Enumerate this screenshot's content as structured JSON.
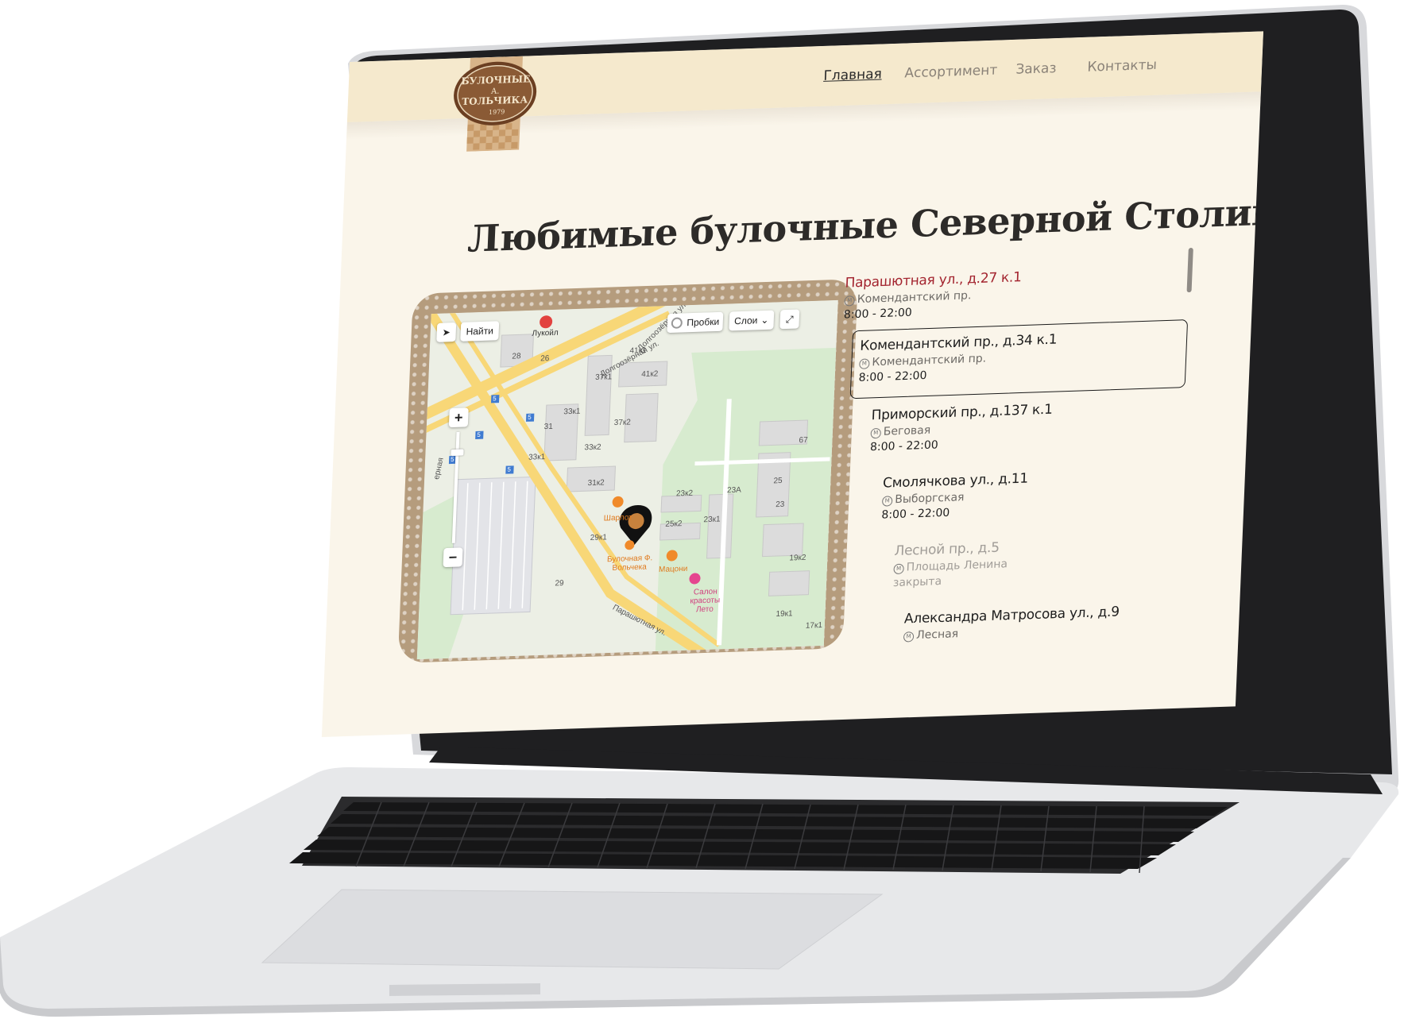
{
  "nav": {
    "home": "Главная",
    "assortment": "Ассортимент",
    "order": "Заказ",
    "contacts": "Контакты"
  },
  "logo": {
    "line1": "БУЛОЧНЫЕ",
    "line2": "А.",
    "line3": "ТОЛЬЧИКА",
    "est": "1979"
  },
  "hero": {
    "title": "Любимые булочные Северной Столицы"
  },
  "map": {
    "find_label": "Найти",
    "traffic_label": "Пробки",
    "layers_label": "Слои",
    "zoom_in": "+",
    "zoom_out": "−",
    "streets": [
      "Долгоозёрная ул.",
      "Долгоозёрная ул.",
      "Парашютная ул.",
      "ерная"
    ],
    "pois": [
      {
        "name": "Лукойл"
      },
      {
        "name": "Шарлот"
      },
      {
        "name": "Булочная Ф. Вольчека"
      },
      {
        "name": "Мацони"
      },
      {
        "name": "Салон красоты Лето"
      }
    ],
    "house_numbers": [
      "28",
      "26",
      "41к1",
      "37к1",
      "41к2",
      "33к1",
      "31",
      "37к2",
      "33к2",
      "33к1",
      "31к2",
      "23к2",
      "25к2",
      "23к1",
      "23А",
      "29к1",
      "25",
      "23",
      "29",
      "19к2",
      "67",
      "19к1",
      "17к1"
    ],
    "bus_stops": [
      "5",
      "5",
      "5",
      "5",
      "5"
    ]
  },
  "addresses": [
    {
      "title": "Парашютная ул., д.27 к.1",
      "metro": "Комендантский пр.",
      "hours": "8:00 - 22:00",
      "state": "active"
    },
    {
      "title": "Комендантский пр., д.34 к.1",
      "metro": "Комендантский пр.",
      "hours": "8:00 - 22:00",
      "state": "selected"
    },
    {
      "title": "Приморский пр., д.137 к.1",
      "metro": "Беговая",
      "hours": "8:00 - 22:00",
      "state": "normal"
    },
    {
      "title": "Смолячкова ул., д.11",
      "metro": "Выборгская",
      "hours": "8:00 - 22:00",
      "state": "normal"
    },
    {
      "title": "Лесной пр., д.5",
      "metro": "Площадь Ленина",
      "hours": "закрыта",
      "state": "closed"
    },
    {
      "title": "Александра Матросова ул., д.9",
      "metro": "Лесная",
      "hours": "",
      "state": "normal"
    }
  ],
  "colors": {
    "header_bg": "#f5e9cd",
    "page_bg": "#faf5ea",
    "active_address": "#a3242f",
    "closed_address": "#a19d98"
  },
  "icons": [
    "location-arrow-icon",
    "traffic-icon",
    "chevron-down-icon",
    "fullscreen-icon",
    "metro-icon",
    "map-pin-icon",
    "fuel-icon",
    "cafe-icon",
    "restaurant-icon",
    "beauty-icon"
  ]
}
